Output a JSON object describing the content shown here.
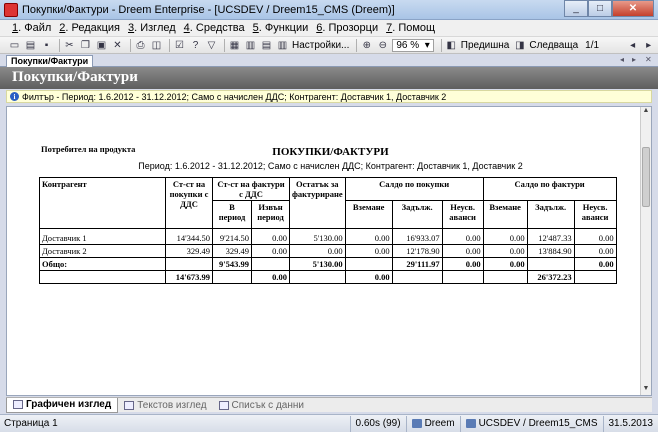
{
  "window": {
    "title": "Покупки/Фактури - Dreem Enterprise - [UCSDEV / Dreem15_CMS (Dreem)]",
    "controls": {
      "minimize": "_",
      "maximize": "□",
      "close": "✕"
    }
  },
  "menu": [
    {
      "key": "1",
      "label": ". Файл"
    },
    {
      "key": "2",
      "label": ". Редакция"
    },
    {
      "key": "3",
      "label": ". Изглед"
    },
    {
      "key": "4",
      "label": ". Средства"
    },
    {
      "key": "5",
      "label": ". Функции"
    },
    {
      "key": "6",
      "label": ". Прозорци"
    },
    {
      "key": "7",
      "label": ". Помощ"
    }
  ],
  "toolbar": {
    "settings_label": "Настройки...",
    "zoom_value": "96 %",
    "prev_label": "Предишна",
    "next_label": "Следваща",
    "page_value": "1/1"
  },
  "doc_tab": {
    "label": "Покупки/Фактури"
  },
  "header": {
    "title": "Покупки/Фактури"
  },
  "filter": {
    "text": "Филтър - Период: 1.6.2012 - 31.12.2012; Само с начислен ДДС; Контрагент: Доставчик 1, Доставчик 2"
  },
  "report": {
    "consumer_label": "Потребител на продукта",
    "title": "ПОКУПКИ/ФАКТУРИ",
    "period": "Период: 1.6.2012 - 31.12.2012; Само с начислен ДДС; Контрагент: Доставчик 1, Доставчик 2",
    "headers": {
      "counterparty": "Контрагент",
      "purchase_value": "Ст-ст на покупки с ДДС",
      "invoice_value": "Ст-ст на фактури с ДДС",
      "in_period": "В период",
      "out_period": "Извън период",
      "invoice_rest": "Остатък за фактуриране",
      "balance_purchases": "Салдо по покупки",
      "balance_invoices": "Салдо по фактури",
      "credit": "Вземане",
      "debt": "Задълж.",
      "unused_advances": "Неусв. аванси"
    },
    "rows": [
      {
        "name": "Доставчик 1",
        "purchase": "14'344.50",
        "in_period": "9'214.50",
        "out_period": "0.00",
        "rest": "5'130.00",
        "p_credit": "0.00",
        "p_debt": "16'933.07",
        "p_adv": "0.00",
        "i_credit": "0.00",
        "i_debt": "12'487.33",
        "i_adv": "0.00"
      },
      {
        "name": "Доставчик 2",
        "purchase": "329.49",
        "in_period": "329.49",
        "out_period": "0.00",
        "rest": "0.00",
        "p_credit": "0.00",
        "p_debt": "12'178.90",
        "p_adv": "0.00",
        "i_credit": "0.00",
        "i_debt": "13'884.90",
        "i_adv": "0.00"
      }
    ],
    "totals": {
      "label": "Общо:",
      "invoice_total": "9'543.99",
      "rest": "5'130.00",
      "p_debt": "29'111.97",
      "p_adv": "0.00",
      "i_credit": "0.00",
      "i_adv": "0.00",
      "purchase": "14'673.99",
      "out_period": "0.00",
      "p_credit": "0.00",
      "i_debt": "26'372.23"
    }
  },
  "view_tabs": [
    {
      "label": "Графичен изглед"
    },
    {
      "label": "Текстов изглед"
    },
    {
      "label": "Списък с данни"
    }
  ],
  "status": {
    "page": "Страница 1",
    "time": "0.60s (99)",
    "user": "Dreem",
    "db": "UCSDEV / Dreem15_CMS",
    "date": "31.5.2013"
  }
}
